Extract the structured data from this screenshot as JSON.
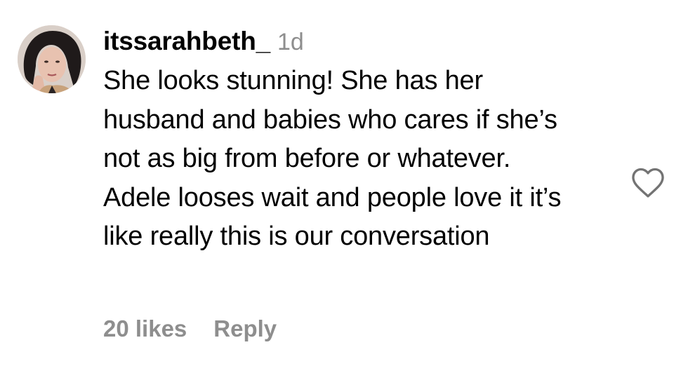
{
  "comment": {
    "username": "itssarahbeth_",
    "timestamp": "1d",
    "text": "She looks stunning! She has her husband and babies who cares if she’s not as big from before or whatever. Adele looses wait and people love it it’s like really this is our conversation",
    "likes": "20 likes",
    "reply_label": "Reply",
    "like_icon": "heart-outline-icon",
    "colors": {
      "text": "#000000",
      "secondary": "#8e8e8e",
      "background": "#ffffff"
    }
  }
}
